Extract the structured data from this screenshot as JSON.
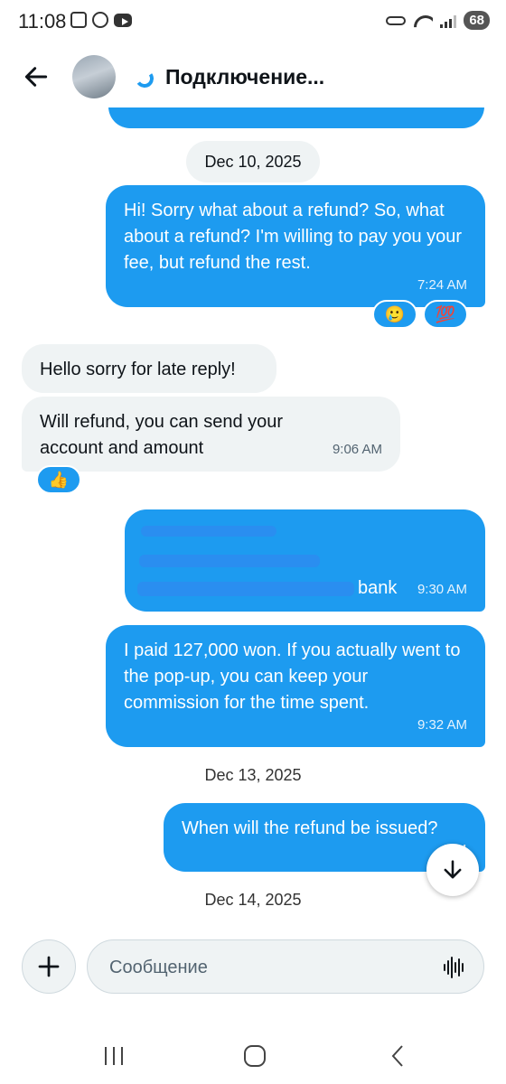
{
  "status_bar": {
    "time": "11:08",
    "battery": "68"
  },
  "header": {
    "title": "Подключение..."
  },
  "messages": {
    "date_1": "Dec 10, 2025",
    "m1": {
      "text": "Hi! Sorry what about a refund? So, what about a refund? I'm willing to pay you your fee, but refund the rest.",
      "time": "7:24 AM",
      "reactions": [
        "🥲",
        "💯"
      ]
    },
    "m2": {
      "text": "Hello sorry for late reply!"
    },
    "m3": {
      "text": "Will refund, you can send your account and amount",
      "time": "9:06 AM",
      "reactions": [
        "👍"
      ]
    },
    "m4": {
      "visible_text": "bank",
      "time": "9:30 AM"
    },
    "m5": {
      "text": "I paid 127,000 won. If you actually went to the pop-up, you can keep your commission for the time spent.",
      "time": "9:32 AM"
    },
    "date_2": "Dec 13, 2025",
    "m6": {
      "text": "When will the refund be issued?",
      "time": "11:4"
    },
    "date_3": "Dec 14, 2025"
  },
  "composer": {
    "placeholder": "Сообщение"
  },
  "colors": {
    "accent": "#1d9bf0",
    "incoming_bubble": "#eff3f4"
  }
}
